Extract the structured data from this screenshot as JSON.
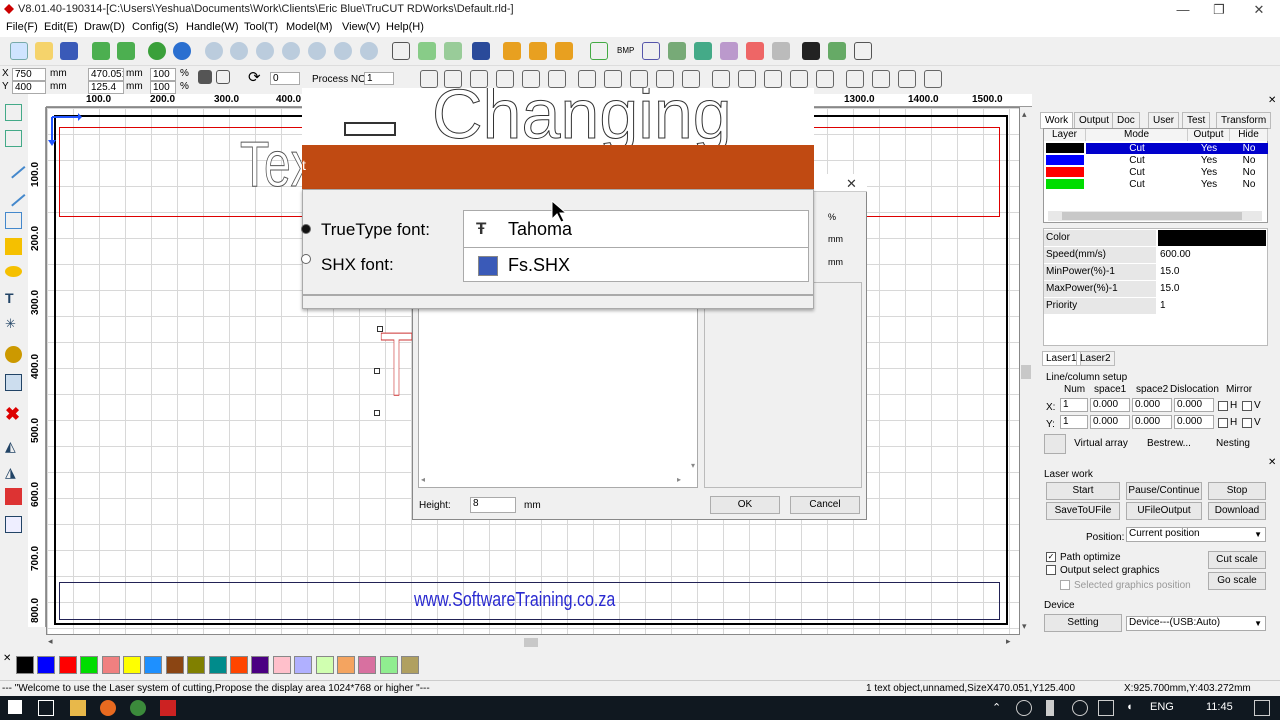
{
  "window": {
    "title": "V8.01.40-190314-[C:\\Users\\Yeshua\\Documents\\Work\\Clients\\Eric Blue\\TruCUT RDWorks\\Default.rld-]",
    "minimize": "—",
    "maximize": "❐",
    "close": "✕"
  },
  "menu": [
    "File(F)",
    "Edit(E)",
    "Draw(D)",
    "Config(S)",
    "Handle(W)",
    "Tool(T)",
    "Model(M)",
    "View(V)",
    "Help(H)"
  ],
  "coords": {
    "x_label": "X",
    "x_value": "750",
    "x_unit": "mm",
    "y_label": "Y",
    "y_value": "400",
    "y_unit": "mm",
    "w_value": "470.051",
    "w_unit": "mm",
    "h_value": "125.4",
    "h_unit": "mm",
    "sx_value": "100",
    "sy_value": "100",
    "pct": "%",
    "rotate_value": "0",
    "process_label": "Process NO:",
    "process_value": "1"
  },
  "ruler_h": [
    "100.0",
    "200.0",
    "300.0",
    "400.0",
    "1300.0",
    "1400.0",
    "1500.0"
  ],
  "ruler_v": [
    "100.0",
    "200.0",
    "300.0",
    "400.0",
    "500.0",
    "600.0",
    "700.0",
    "800.0"
  ],
  "canvas": {
    "text_object": "Tex",
    "small_text": "T",
    "watermark": "www.SoftwareTraining.co.za"
  },
  "dialog": {
    "title_fragment": "t",
    "preview_text": "Changing",
    "truetype_label": "TrueType font:",
    "truetype_value": "Tahoma",
    "shx_label": "SHX font:",
    "shx_value": "Fs.SHX",
    "unit_pct": "%",
    "unit_mm1": "mm",
    "unit_mm2": "mm",
    "height_label": "Height:",
    "height_value": "8",
    "height_unit": "mm",
    "ok": "OK",
    "cancel": "Cancel",
    "close": "✕"
  },
  "right_tabs": [
    "Work",
    "Output",
    "Doc",
    "User",
    "Test",
    "Transform"
  ],
  "layers": {
    "headers": [
      "Layer",
      "Mode",
      "Output",
      "Hide"
    ],
    "rows": [
      {
        "color": "#000000",
        "mode": "Cut",
        "output": "Yes",
        "hide": "No"
      },
      {
        "color": "#0000ff",
        "mode": "Cut",
        "output": "Yes",
        "hide": "No"
      },
      {
        "color": "#ff0000",
        "mode": "Cut",
        "output": "Yes",
        "hide": "No"
      },
      {
        "color": "#00dd00",
        "mode": "Cut",
        "output": "Yes",
        "hide": "No"
      }
    ]
  },
  "properties": [
    {
      "key": "Color",
      "value": ""
    },
    {
      "key": "Speed(mm/s)",
      "value": "600.00"
    },
    {
      "key": "MinPower(%)-1",
      "value": "15.0"
    },
    {
      "key": "MaxPower(%)-1",
      "value": "15.0"
    },
    {
      "key": "Priority",
      "value": "1"
    }
  ],
  "laser_tabs": [
    "Laser1",
    "Laser2"
  ],
  "array": {
    "title": "Line/column setup",
    "headers": [
      "Num",
      "space1",
      "space2",
      "Dislocation",
      "Mirror"
    ],
    "x_label": "X:",
    "y_label": "Y:",
    "x_vals": [
      "1",
      "0.000",
      "0.000",
      "0.000"
    ],
    "y_vals": [
      "1",
      "0.000",
      "0.000",
      "0.000"
    ],
    "h": "H",
    "v": "V",
    "virtual_array": "Virtual array",
    "bestrew": "Bestrew...",
    "nesting": "Nesting"
  },
  "laserwork": {
    "title": "Laser work",
    "start": "Start",
    "pause": "Pause/Continue",
    "stop": "Stop",
    "save_u": "SaveToUFile",
    "ufile_output": "UFileOutput",
    "download": "Download",
    "position_label": "Position:",
    "position_value": "Current position",
    "path_optimize": "Path optimize",
    "output_select": "Output select graphics",
    "selected_pos": "Selected graphics position",
    "cut_scale": "Cut scale",
    "go_scale": "Go scale"
  },
  "device": {
    "title": "Device",
    "setting": "Setting",
    "value": "Device---(USB:Auto)"
  },
  "palette": [
    "#000000",
    "#0000ff",
    "#ff0000",
    "#00dd00",
    "#f08080",
    "#ffff00",
    "#1e90ff",
    "#8b4513",
    "#808000",
    "#008b8b",
    "#ff4500",
    "#4b0082",
    "#ffc0cb",
    "#b0b0ff",
    "#d0ffb0",
    "#f4a460",
    "#d870a0",
    "#90ee90",
    "#b0a060"
  ],
  "status": {
    "left": "--- \"Welcome to use the Laser system of cutting,Propose the display area 1024*768 or higher \"---",
    "middle": "1 text object,unnamed,SizeX470.051,Y125.400",
    "right": "X:925.700mm,Y:403.272mm"
  },
  "taskbar": {
    "lang": "ENG",
    "time": "11:45"
  }
}
